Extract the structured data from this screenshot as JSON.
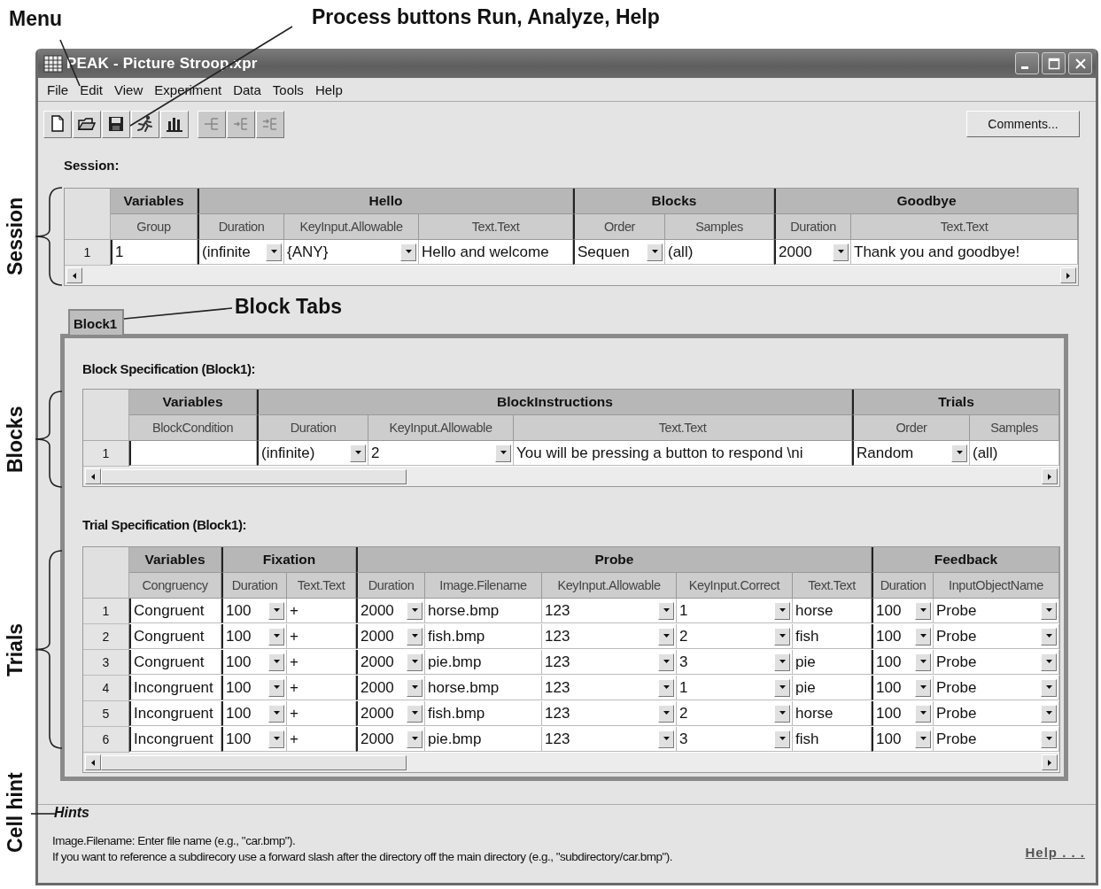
{
  "annotations": [
    {
      "text": "Menu",
      "kind": "caption"
    },
    {
      "text": "Process buttons Run, Analyze, Help",
      "kind": "caption"
    },
    {
      "text": "Block Tabs",
      "kind": "caption"
    },
    {
      "text": "Session",
      "kind": "brace"
    },
    {
      "text": "Blocks",
      "kind": "brace"
    },
    {
      "text": "Trials",
      "kind": "brace"
    },
    {
      "text": "Cell hint",
      "kind": "pointer"
    }
  ],
  "window": {
    "title": "PEAK - Picture Stroop.xpr"
  },
  "menu": [
    {
      "label": "File"
    },
    {
      "label": "Edit"
    },
    {
      "label": "View"
    },
    {
      "label": "Experiment"
    },
    {
      "label": "Data"
    },
    {
      "label": "Tools"
    },
    {
      "label": "Help"
    }
  ],
  "toolbar": [
    {
      "kind": "new",
      "disabled": false
    },
    {
      "kind": "open",
      "disabled": false
    },
    {
      "kind": "save",
      "disabled": false
    },
    {
      "kind": "run",
      "disabled": false
    },
    {
      "kind": "analyze",
      "disabled": false
    },
    {
      "kind": "indent-left",
      "disabled": true
    },
    {
      "kind": "indent-mid",
      "disabled": true
    },
    {
      "kind": "indent-right",
      "disabled": true
    }
  ],
  "comments_button": {
    "label": "Comments..."
  },
  "session": {
    "title": "Session:",
    "groups": [
      {
        "label": "Variables",
        "columns": [
          {
            "label": "Group",
            "kind": "text"
          }
        ]
      },
      {
        "label": "Hello",
        "columns": [
          {
            "label": "Duration",
            "kind": "dropdown"
          },
          {
            "label": "KeyInput.Allowable",
            "kind": "dropdown"
          },
          {
            "label": "Text.Text",
            "kind": "text"
          }
        ]
      },
      {
        "label": "Blocks",
        "columns": [
          {
            "label": "Order",
            "kind": "dropdown"
          },
          {
            "label": "Samples",
            "kind": "text"
          }
        ]
      },
      {
        "label": "Goodbye",
        "columns": [
          {
            "label": "Duration",
            "kind": "dropdown"
          },
          {
            "label": "Text.Text",
            "kind": "text"
          }
        ]
      }
    ],
    "rows": [
      {
        "number": "1",
        "cells": [
          "1",
          "(infinite",
          "{ANY}",
          "Hello and welcome",
          "Sequen",
          "(all)",
          "2000",
          "Thank you and goodbye!"
        ]
      }
    ]
  },
  "tabs": [
    {
      "label": "Block1",
      "selected": true
    }
  ],
  "block_spec": {
    "title": "Block Specification (Block1):",
    "groups": [
      {
        "label": "Variables",
        "columns": [
          {
            "label": "BlockCondition",
            "kind": "text"
          }
        ]
      },
      {
        "label": "BlockInstructions",
        "columns": [
          {
            "label": "Duration",
            "kind": "dropdown"
          },
          {
            "label": "KeyInput.Allowable",
            "kind": "dropdown"
          },
          {
            "label": "Text.Text",
            "kind": "text"
          }
        ]
      },
      {
        "label": "Trials",
        "columns": [
          {
            "label": "Order",
            "kind": "dropdown"
          },
          {
            "label": "Samples",
            "kind": "text"
          }
        ]
      }
    ],
    "rows": [
      {
        "number": "1",
        "cells": [
          "",
          "(infinite)",
          "2",
          "You will be pressing a button to respond \\ni",
          "Random",
          "(all)"
        ]
      }
    ]
  },
  "trial_spec": {
    "title": "Trial Specification (Block1):",
    "groups": [
      {
        "label": "Variables",
        "columns": [
          {
            "label": "Congruency",
            "kind": "text"
          }
        ]
      },
      {
        "label": "Fixation",
        "columns": [
          {
            "label": "Duration",
            "kind": "dropdown"
          },
          {
            "label": "Text.Text",
            "kind": "text"
          }
        ]
      },
      {
        "label": "Probe",
        "columns": [
          {
            "label": "Duration",
            "kind": "dropdown"
          },
          {
            "label": "Image.Filename",
            "kind": "text"
          },
          {
            "label": "KeyInput.Allowable",
            "kind": "dropdown"
          },
          {
            "label": "KeyInput.Correct",
            "kind": "dropdown"
          },
          {
            "label": "Text.Text",
            "kind": "text"
          }
        ]
      },
      {
        "label": "Feedback",
        "columns": [
          {
            "label": "Duration",
            "kind": "dropdown"
          },
          {
            "label": "InputObjectName",
            "kind": "dropdown"
          }
        ]
      }
    ],
    "rows": [
      {
        "number": "1",
        "cells": [
          "Congruent",
          "100",
          "+",
          "2000",
          "horse.bmp",
          "123",
          "1",
          "horse",
          "100",
          "Probe"
        ]
      },
      {
        "number": "2",
        "cells": [
          "Congruent",
          "100",
          "+",
          "2000",
          "fish.bmp",
          "123",
          "2",
          "fish",
          "100",
          "Probe"
        ]
      },
      {
        "number": "3",
        "cells": [
          "Congruent",
          "100",
          "+",
          "2000",
          "pie.bmp",
          "123",
          "3",
          "pie",
          "100",
          "Probe"
        ]
      },
      {
        "number": "4",
        "cells": [
          "Incongruent",
          "100",
          "+",
          "2000",
          "horse.bmp",
          "123",
          "1",
          "pie",
          "100",
          "Probe"
        ]
      },
      {
        "number": "5",
        "cells": [
          "Incongruent",
          "100",
          "+",
          "2000",
          "fish.bmp",
          "123",
          "2",
          "horse",
          "100",
          "Probe"
        ]
      },
      {
        "number": "6",
        "cells": [
          "Incongruent",
          "100",
          "+",
          "2000",
          "pie.bmp",
          "123",
          "3",
          "fish",
          "100",
          "Probe"
        ]
      }
    ]
  },
  "hints": {
    "title": "Hints",
    "lines": [
      "Image.Filename: Enter file name (e.g., \"car.bmp\").",
      "If you want to reference a subdirecory use a forward slash after the directory off the main directory (e.g., \"subdirectory/car.bmp\")."
    ],
    "help_link": "Help . . ."
  }
}
